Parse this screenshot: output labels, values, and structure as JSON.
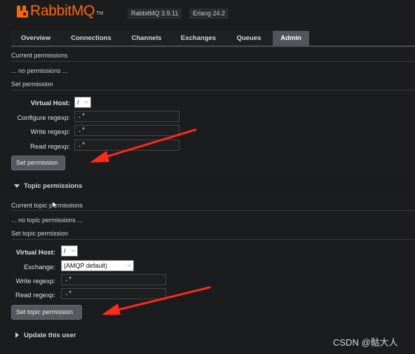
{
  "header": {
    "logo_text": "RabbitMQ",
    "logo_tm": "TM",
    "rabbitmq_version": "RabbitMQ 3.9.11",
    "erlang_version": "Erlang 24.2"
  },
  "tabs": [
    {
      "label": "Overview"
    },
    {
      "label": "Connections"
    },
    {
      "label": "Channels"
    },
    {
      "label": "Exchanges"
    },
    {
      "label": "Queues"
    },
    {
      "label": "Admin"
    }
  ],
  "permissions": {
    "current_heading": "Current permissions",
    "empty_text": "... no permissions ...",
    "set_heading": "Set permission",
    "vhost_label": "Virtual Host:",
    "vhost_value": "/",
    "configure_label": "Configure regexp:",
    "configure_value": ".*",
    "write_label": "Write regexp:",
    "write_value": ".*",
    "read_label": "Read regexp:",
    "read_value": ".*",
    "submit_label": "Set permission"
  },
  "topic_permissions": {
    "section_title": "Topic permissions",
    "current_heading": "Current topic permissions",
    "empty_text": "... no topic permissions ...",
    "set_heading": "Set topic permission",
    "vhost_label": "Virtual Host:",
    "vhost_value": "/",
    "exchange_label": "Exchange:",
    "exchange_value": "(AMQP default)",
    "write_label": "Write regexp:",
    "write_value": ".*",
    "read_label": "Read regexp:",
    "read_value": ".*",
    "submit_label": "Set topic permission"
  },
  "update_user": {
    "section_title": "Update this user"
  },
  "watermark": "CSDN @骷大人",
  "colors": {
    "brand": "#ff6600",
    "background": "#1b1c1e",
    "active_tab": "#52565b",
    "annotation_arrow": "#ff2a1a"
  },
  "icons": {
    "logo": "rabbitmq-logo-icon",
    "expand": "triangle-down-icon",
    "collapse": "triangle-right-icon",
    "select": "chevron-down-icon",
    "pointer": "mouse-cursor-icon"
  }
}
